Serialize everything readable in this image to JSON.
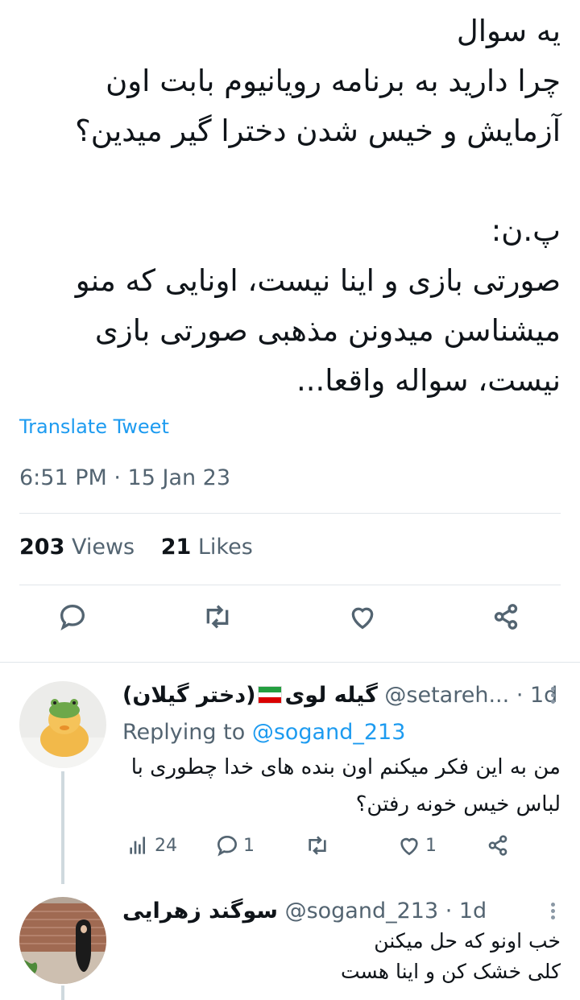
{
  "tweet": {
    "lines": [
      "یه سوال",
      "چرا دارید به برنامه رویانیوم بابت اون",
      "آزمایش و خیس شدن دخترا گیر میدین؟",
      "",
      "پ.ن:",
      "صورتی بازی و اینا نیست، اونایی که منو",
      "میشناسن میدونن مذهبی صورتی بازی",
      "نیست، سواله واقعا..."
    ],
    "translate_label": "Translate Tweet",
    "timestamp": "6:51 PM · 15 Jan 23",
    "views_count": "203",
    "views_label": "Views",
    "likes_count": "21",
    "likes_label": "Likes"
  },
  "actions": {
    "icons": [
      "reply-icon",
      "retweet-icon",
      "like-icon",
      "share-icon"
    ]
  },
  "replies": [
    {
      "name": "گیله لوی 🇮🇷(دختر گیلان)",
      "name_left": "(دختر گیلان)",
      "name_right": "گیله لوی",
      "handle": "@setareh...",
      "time": "· 1d",
      "replying_prefix": "Replying to",
      "replying_to": "@sogand_213",
      "lines": [
        "من به این فکر میکنم اون بنده های خدا چطوری با",
        "لباس خیس خونه رفتن؟"
      ],
      "views": "24",
      "replies": "1",
      "retweets": "",
      "likes": "1"
    },
    {
      "name": "سوگند زهرایی",
      "handle": "@sogand_213",
      "time": "· 1d",
      "lines": [
        "خب اونو که حل میکنن",
        "کلی خشک کن و اینا هست"
      ]
    }
  ],
  "colors": {
    "accent": "#1d9bf0",
    "secondary_text": "#536471",
    "primary_text": "#0f1419",
    "divider": "#e1e6ea"
  }
}
